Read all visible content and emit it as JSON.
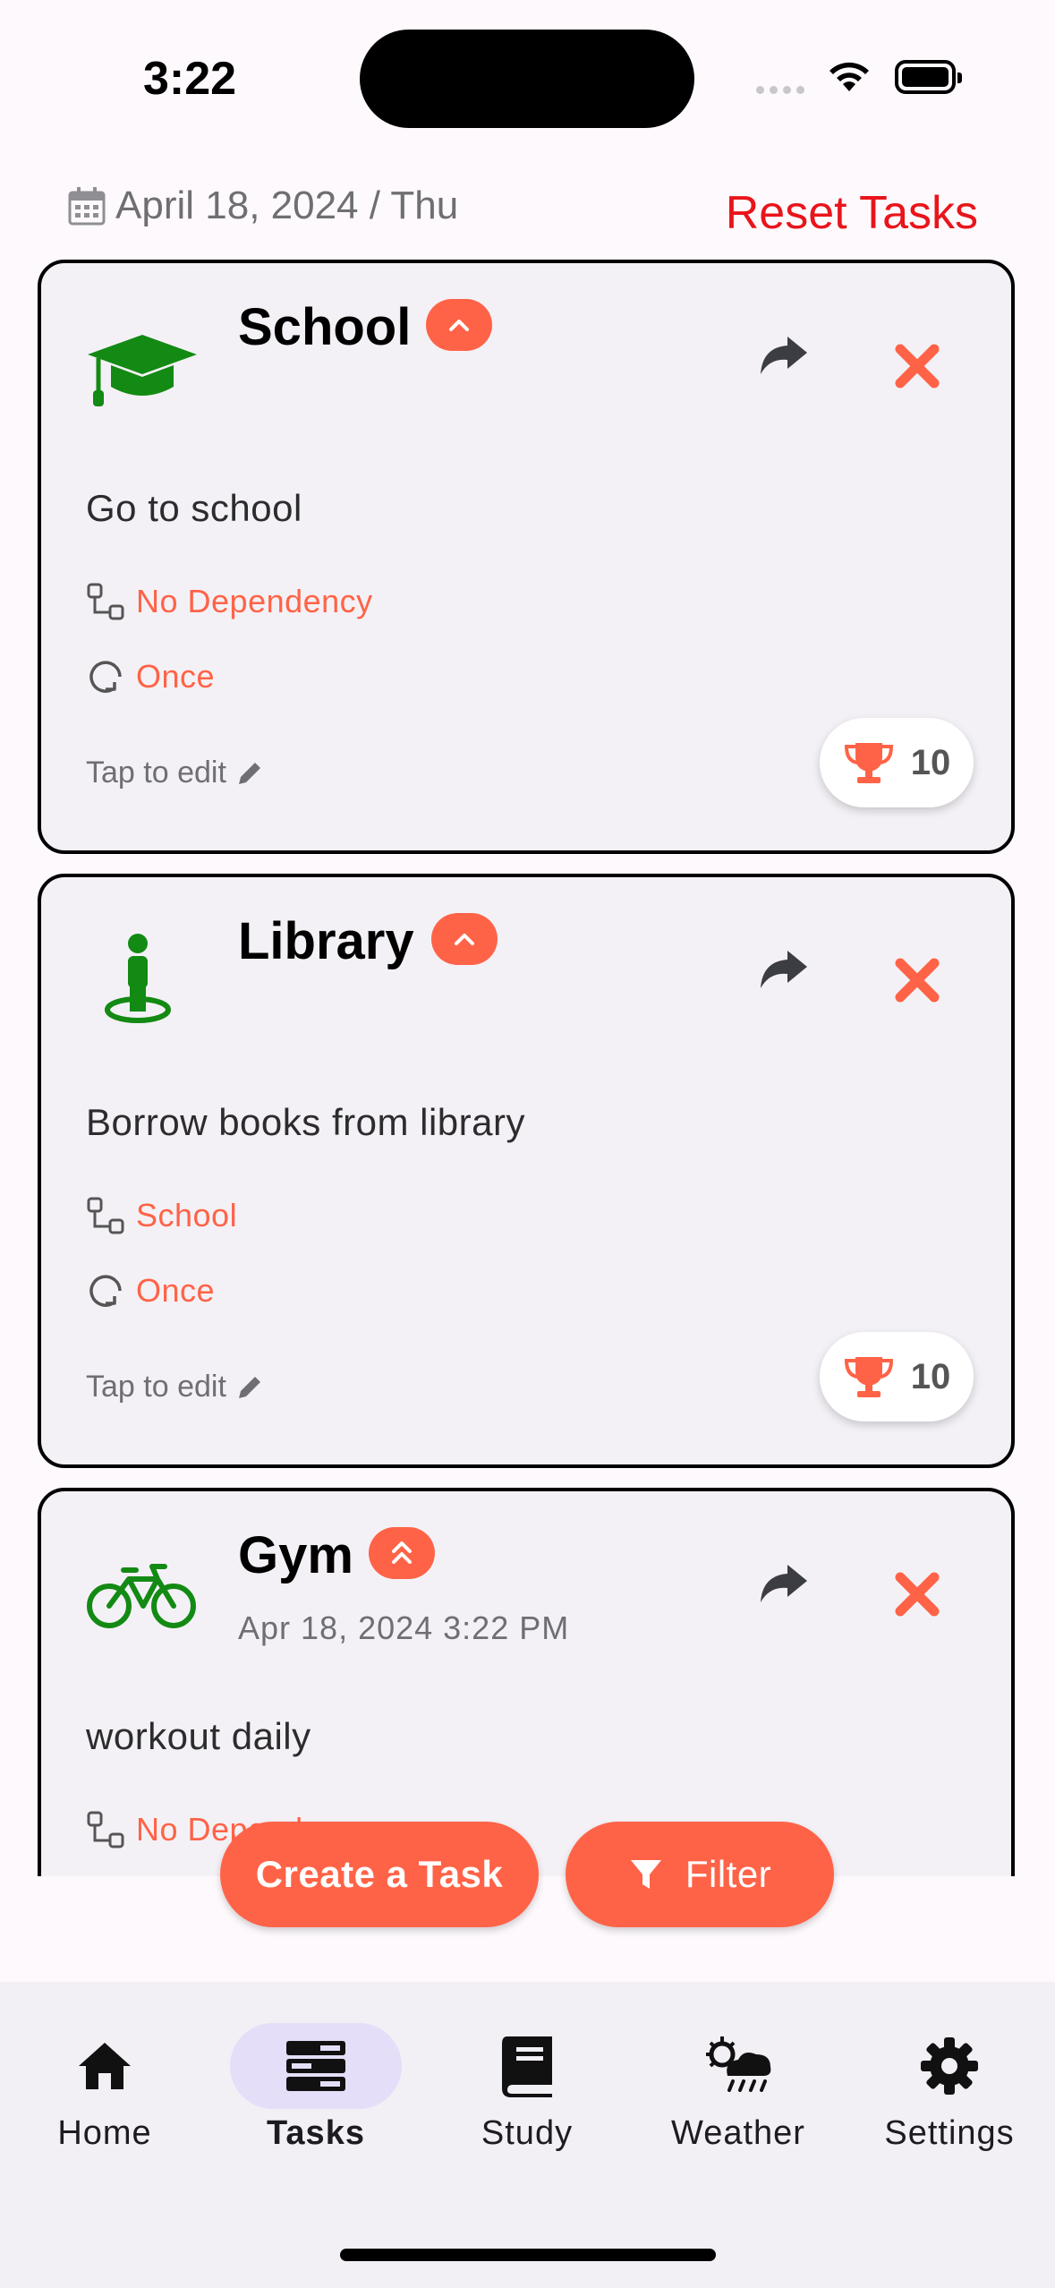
{
  "status": {
    "time": "3:22"
  },
  "header": {
    "date": "April 18, 2024 / Thu",
    "reset_label": "Reset Tasks"
  },
  "tasks": [
    {
      "title": "School",
      "description": "Go to school",
      "dependency": "No Dependency",
      "repeat": "Once",
      "edit_label": "Tap to edit",
      "points": "10",
      "icon": "graduation-cap-icon",
      "priority": "medium"
    },
    {
      "title": "Library",
      "description": "Borrow books from library",
      "dependency": "School",
      "repeat": "Once",
      "edit_label": "Tap to edit",
      "points": "10",
      "icon": "location-person-icon",
      "priority": "medium"
    },
    {
      "title": "Gym",
      "date": "Apr 18, 2024 3:22 PM",
      "description": "workout daily",
      "dependency": "No Dependency",
      "icon": "bicycle-icon",
      "priority": "high"
    }
  ],
  "actions": {
    "create_label": "Create a Task",
    "filter_label": "Filter"
  },
  "nav": {
    "items": [
      {
        "label": "Home",
        "icon": "home-icon"
      },
      {
        "label": "Tasks",
        "icon": "tasks-icon",
        "active": true
      },
      {
        "label": "Study",
        "icon": "book-icon"
      },
      {
        "label": "Weather",
        "icon": "weather-icon"
      },
      {
        "label": "Settings",
        "icon": "gear-icon"
      }
    ]
  },
  "colors": {
    "accent": "#FF6347",
    "reset": "#E8151B",
    "icon_green": "#138A13",
    "nav_bg": "#F2EFF5",
    "active_pill": "#E5DEF8"
  }
}
